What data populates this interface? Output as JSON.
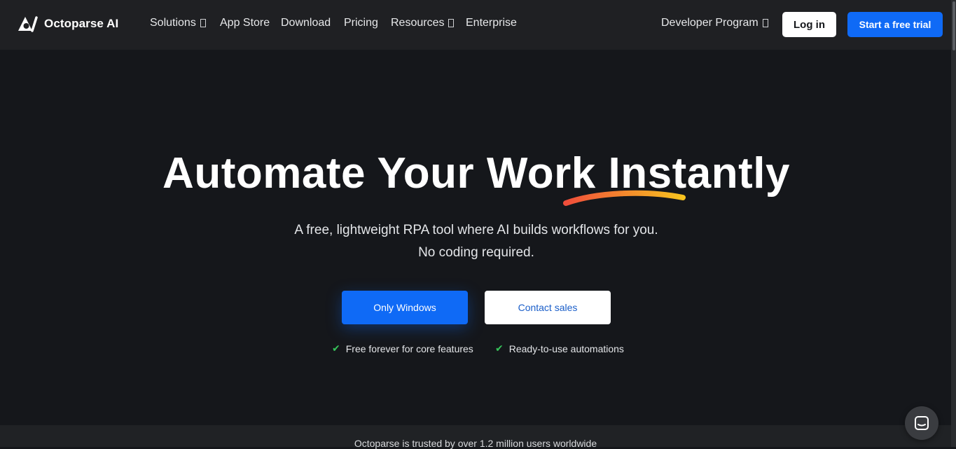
{
  "header": {
    "brand": "Octoparse AI",
    "nav": [
      {
        "label": "Solutions",
        "has_dropdown": true
      },
      {
        "label": "App Store",
        "has_dropdown": false
      },
      {
        "label": "Download",
        "has_dropdown": false
      },
      {
        "label": "Pricing",
        "has_dropdown": false
      },
      {
        "label": "Resources",
        "has_dropdown": true
      },
      {
        "label": "Enterprise",
        "has_dropdown": false
      }
    ],
    "developer_program": "Developer Program",
    "login_label": "Log in",
    "trial_label": "Start a free trial"
  },
  "hero": {
    "title": "Automate Your Work Instantly",
    "subtitle_line1": "A free, lightweight RPA tool where AI builds workflows for you.",
    "subtitle_line2": "No coding required.",
    "primary_button": "Only Windows",
    "secondary_button": "Contact sales",
    "features": [
      "Free forever for core features",
      "Ready-to-use automations"
    ]
  },
  "trust": {
    "text": "Octoparse is trusted by over 1.2 million users worldwide"
  },
  "icons": {
    "logo": "octoparse-logo-icon",
    "check": "check-icon",
    "chat": "chat-icon",
    "dropdown": "chevron-down-icon"
  },
  "colors": {
    "background": "#15171b",
    "header": "#1f2023",
    "accent_blue": "#0f6af6",
    "check_green": "#36c45a",
    "swoosh_start": "#f04e3b",
    "swoosh_end": "#f7c31f"
  }
}
